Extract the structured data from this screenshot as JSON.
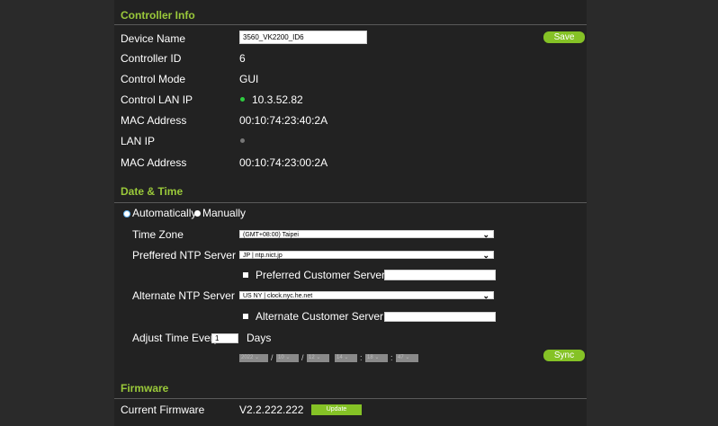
{
  "colors": {
    "accent": "#85c226",
    "section_title": "#9ac93a",
    "status_online": "#2ecc40",
    "status_offline": "#777777"
  },
  "controller_info": {
    "title": "Controller Info",
    "device_name_label": "Device Name",
    "device_name_value": "3560_VK2200_ID6",
    "save_label": "Save",
    "controller_id_label": "Controller ID",
    "controller_id_value": "6",
    "control_mode_label": "Control Mode",
    "control_mode_value": "GUI",
    "control_lan_ip_label": "Control LAN IP",
    "control_lan_ip_value": "10.3.52.82",
    "mac_address_label_1": "MAC Address",
    "mac_address_value_1": "00:10:74:23:40:2A",
    "lan_ip_label": "LAN IP",
    "lan_ip_value": "",
    "mac_address_label_2": "MAC Address",
    "mac_address_value_2": "00:10:74:23:00:2A"
  },
  "date_time": {
    "title": "Date & Time",
    "mode_automatic": "Automatically",
    "mode_manual": "Manually",
    "selected_mode": "Automatically",
    "time_zone_label": "Time Zone",
    "time_zone_value": "(GMT+08:00) Taipei",
    "preferred_ntp_label": "Preffered NTP Server",
    "preferred_ntp_value": "JP | ntp.nict.jp",
    "preferred_custom_label": "Preferred Customer Server IP",
    "preferred_custom_value": "",
    "alternate_ntp_label": "Alternate NTP Server",
    "alternate_ntp_value": "US NY | clock.nyc.he.net",
    "alternate_custom_label": "Alternate Customer Server IP",
    "alternate_custom_value": "",
    "adjust_label": "Adjust Time Every",
    "adjust_value": "1",
    "adjust_unit": "Days",
    "year": "2022",
    "month": "10",
    "day": "12",
    "hour": "14",
    "minute": "18",
    "second": "47",
    "date_sep": "/",
    "time_sep": ":",
    "sync_label": "Sync"
  },
  "firmware": {
    "title": "Firmware",
    "current_label": "Current Firmware",
    "current_value": "V2.2.222.222",
    "update_label": "Update"
  }
}
